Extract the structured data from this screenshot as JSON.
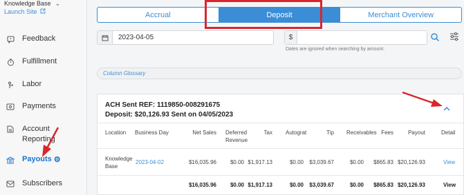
{
  "sidebar": {
    "knowledge_base": "Knowledge Base",
    "launch_site": "Launch Site",
    "items": [
      {
        "label": "Feedback",
        "icon": "feedback-icon"
      },
      {
        "label": "Fulfillment",
        "icon": "timer-icon"
      },
      {
        "label": "Labor",
        "icon": "labor-icon"
      },
      {
        "label": "Payments",
        "icon": "payments-icon"
      },
      {
        "label": "Account Reporting",
        "icon": "report-icon"
      },
      {
        "label": "Payouts",
        "icon": "bank-icon",
        "active": true
      },
      {
        "label": "Subscribers",
        "icon": "mail-icon"
      }
    ]
  },
  "tabs": [
    "Accrual",
    "Deposit",
    "Merchant Overview"
  ],
  "active_tab": "Deposit",
  "filters": {
    "date": "2023-04-05",
    "amount_prefix": "$",
    "amount_value": "",
    "amount_hint": "Dates are ignored when searching by amount."
  },
  "glossary_label": "Column Glossary",
  "deposit": {
    "ach_ref": "ACH Sent REF: 1119850-008291675",
    "summary": "Deposit: $20,126.93 Sent on 04/05/2023",
    "columns": [
      "Location",
      "Business Day",
      "Net Sales",
      "Deferred Revenue",
      "Tax",
      "Autograt",
      "Tip",
      "Receivables",
      "Fees",
      "Payout",
      "Detail"
    ],
    "row": {
      "location": "Knowledge Base",
      "business_day": "2023-04-02",
      "net_sales": "$16,035.96",
      "deferred_revenue": "$0.00",
      "tax": "$1,917.13",
      "autograt": "$0.00",
      "tip": "$3,039.67",
      "receivables": "$0.00",
      "fees": "$865.83",
      "payout": "$20,126.93",
      "detail": "View"
    },
    "total": {
      "net_sales": "$16,035.96",
      "deferred_revenue": "$0.00",
      "tax": "$1,917.13",
      "autograt": "$0.00",
      "tip": "$3,039.67",
      "receivables": "$0.00",
      "fees": "$865.83",
      "payout": "$20,126.93",
      "detail": "View"
    }
  },
  "colors": {
    "accent": "#3b8dd6",
    "annotation": "#d8262c"
  }
}
